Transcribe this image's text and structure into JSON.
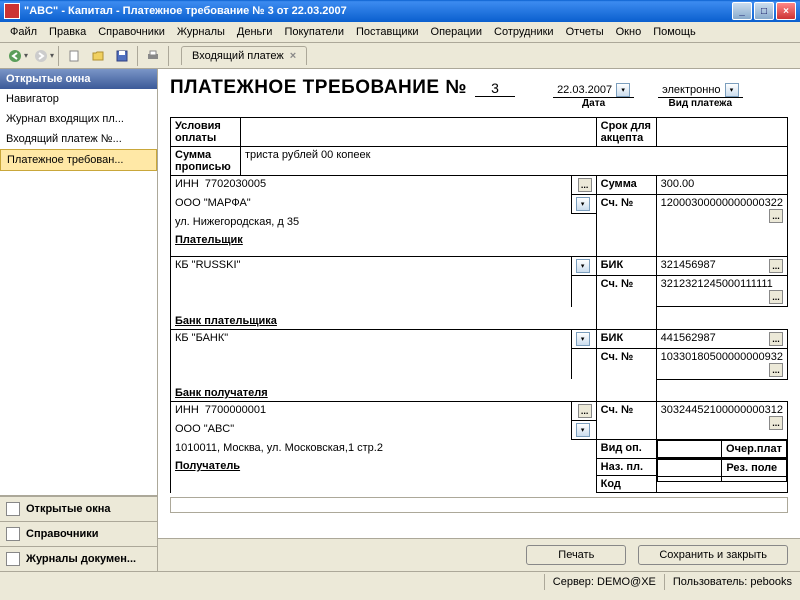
{
  "window": {
    "title": "\"ABC\" - Капитал - Платежное требование № 3 от 22.03.2007"
  },
  "menu": [
    "Файл",
    "Правка",
    "Справочники",
    "Журналы",
    "Деньги",
    "Покупатели",
    "Поставщики",
    "Операции",
    "Сотрудники",
    "Отчеты",
    "Окно",
    "Помощь"
  ],
  "tab": {
    "label": "Входящий платеж"
  },
  "sidebar": {
    "header": "Открытые окна",
    "items": [
      "Навигатор",
      "Журнал входящих пл...",
      "Входящий платеж №...",
      "Платежное требован..."
    ],
    "active_index": 3,
    "buttons": [
      "Открытые окна",
      "Справочники",
      "Журналы докумен..."
    ]
  },
  "doc": {
    "title_prefix": "ПЛАТЕЖНОЕ ТРЕБОВАНИЕ №",
    "number": "3",
    "date": "22.03.2007",
    "date_label": "Дата",
    "paytype": "электронно",
    "paytype_label": "Вид платежа",
    "cond_label": "Условия оплаты",
    "accept_label": "Срок для акцепта",
    "sum_words_label": "Сумма прописью",
    "sum_words": "триста рублей 00 копеек",
    "inn1_label": "ИНН",
    "inn1": "7702030005",
    "payer_name": "ООО \"МАРФА\"",
    "payer_addr": "ул. Нижегородская, д 35",
    "sum_label": "Сумма",
    "sum": "300.00",
    "acc_label": "Сч. №",
    "acc1": "12000300000000000322",
    "payer_section": "Плательщик",
    "bank1": "КБ \"RUSSKI\"",
    "bik_label": "БИК",
    "bik1": "321456987",
    "acc2": "3212321245000111111",
    "bank_payer_section": "Банк плательщика",
    "bank2": "КБ \"БАНК\"",
    "bik2": "441562987",
    "acc3": "10330180500000000932",
    "bank_recv_section": "Банк получателя",
    "inn2_label": "ИНН",
    "inn2": "7700000001",
    "recv_name": "ООО \"ABC\"",
    "recv_addr": "1010011, Москва, ул. Московская,1 стр.2",
    "acc4": "30324452100000000312",
    "vidop_label": "Вид оп.",
    "nazpl_label": "Наз. пл.",
    "kod_label": "Код",
    "ocher_label": "Очер.плат",
    "rez_label": "Рез. поле",
    "recv_section": "Получатель"
  },
  "buttons": {
    "print": "Печать",
    "save": "Сохранить и закрыть"
  },
  "status": {
    "server_label": "Сервер:",
    "server": "DEMO@XE",
    "user_label": "Пользователь:",
    "user": "pebooks"
  }
}
